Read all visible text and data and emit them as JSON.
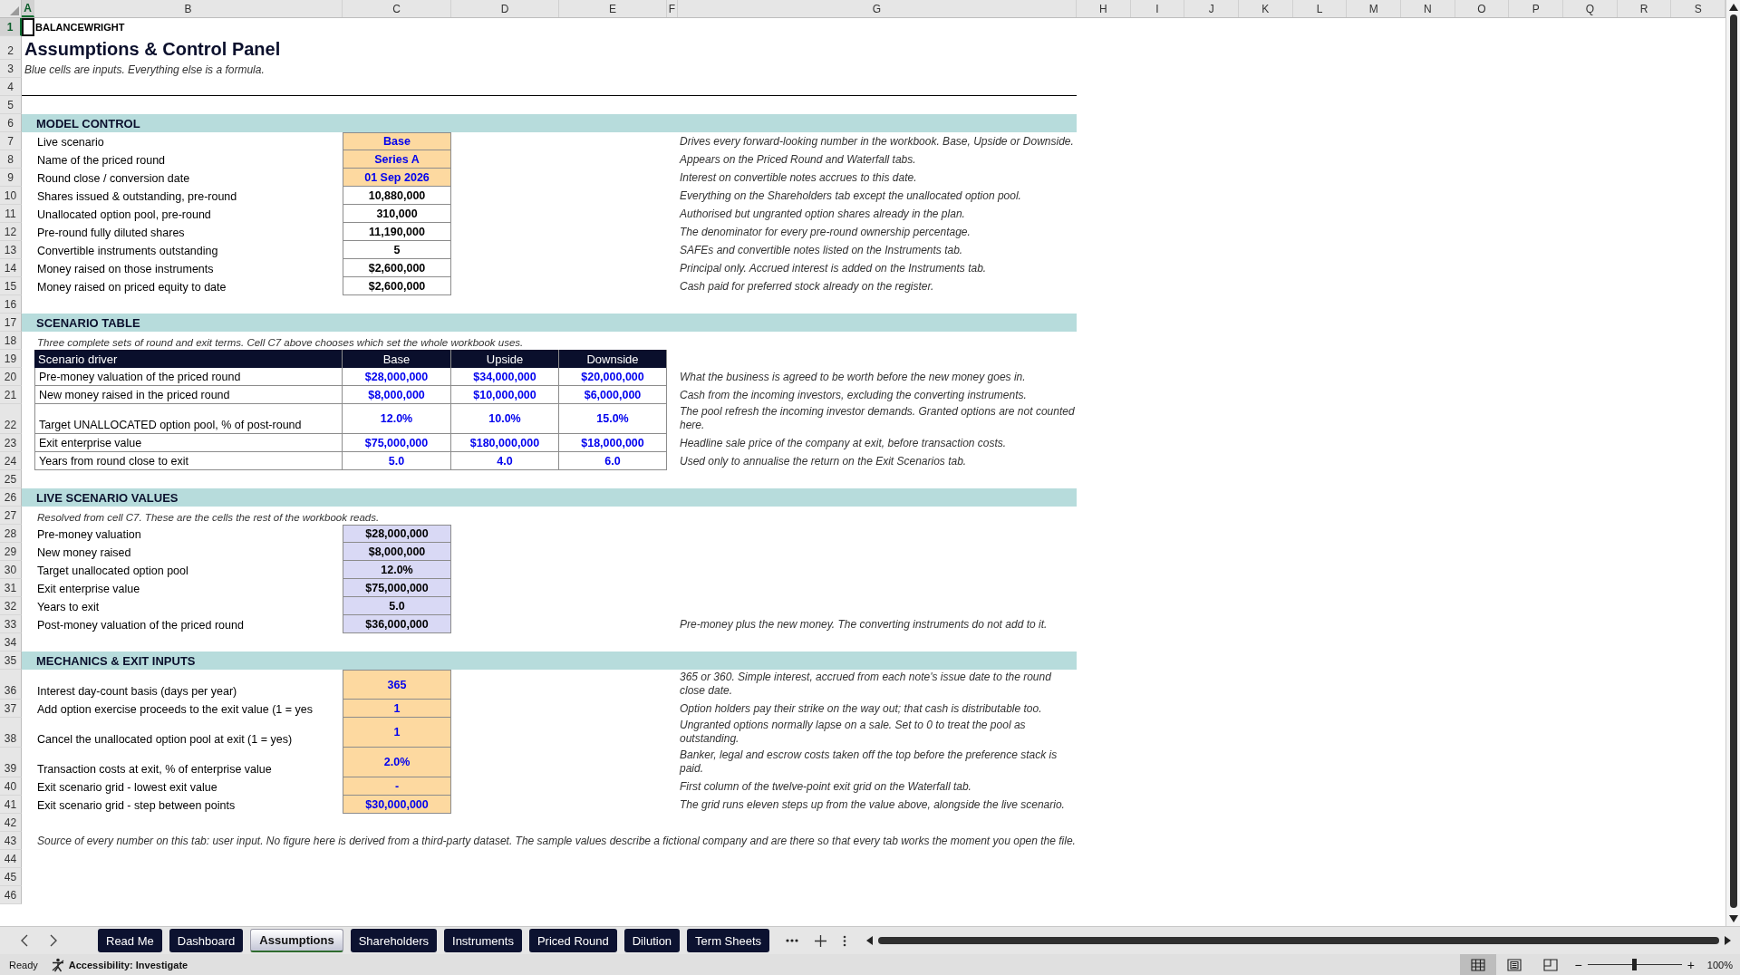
{
  "column_headers": [
    {
      "letter": "A",
      "selected": true
    },
    {
      "letter": "B",
      "selected": false
    },
    {
      "letter": "C",
      "selected": false
    },
    {
      "letter": "D",
      "selected": false
    },
    {
      "letter": "E",
      "selected": false
    },
    {
      "letter": "F",
      "selected": false
    },
    {
      "letter": "G",
      "selected": false
    },
    {
      "letter": "H",
      "selected": false
    },
    {
      "letter": "I",
      "selected": false
    },
    {
      "letter": "J",
      "selected": false
    },
    {
      "letter": "K",
      "selected": false
    },
    {
      "letter": "L",
      "selected": false
    },
    {
      "letter": "M",
      "selected": false
    },
    {
      "letter": "N",
      "selected": false
    },
    {
      "letter": "O",
      "selected": false
    },
    {
      "letter": "P",
      "selected": false
    },
    {
      "letter": "Q",
      "selected": false
    },
    {
      "letter": "R",
      "selected": false
    },
    {
      "letter": "S",
      "selected": false
    }
  ],
  "rows": [
    {
      "row": "1",
      "selected": true,
      "kind": "brand",
      "text": "BALANCEWRIGHT"
    },
    {
      "row": "2",
      "selected": false,
      "kind": "title",
      "text": "Assumptions & Control Panel"
    },
    {
      "row": "3",
      "selected": false,
      "kind": "subtitle",
      "text": "Blue cells are inputs. Everything else is a formula."
    },
    {
      "row": "4",
      "selected": false,
      "kind": "rule"
    },
    {
      "row": "5",
      "selected": false,
      "kind": "blank"
    },
    {
      "row": "6",
      "selected": false,
      "kind": "section",
      "text": "MODEL CONTROL"
    },
    {
      "row": "7",
      "selected": false,
      "kind": "value",
      "label": "Live scenario",
      "value": "Base",
      "input": true,
      "note": "Drives every forward-looking number in the workbook. Base, Upside or Downside."
    },
    {
      "row": "8",
      "selected": false,
      "kind": "value",
      "label": "Name of the priced round",
      "value": "Series A",
      "input": true,
      "note": "Appears on the Priced Round and Waterfall tabs."
    },
    {
      "row": "9",
      "selected": false,
      "kind": "value",
      "label": "Round close / conversion date",
      "value": "01 Sep 2026",
      "input": true,
      "note": "Interest on convertible notes accrues to this date."
    },
    {
      "row": "10",
      "selected": false,
      "kind": "value",
      "label": "Shares issued & outstanding, pre-round",
      "value": "10,880,000",
      "input": false,
      "note": "Everything on the Shareholders tab except the unallocated option pool."
    },
    {
      "row": "11",
      "selected": false,
      "kind": "value",
      "label": "Unallocated option pool, pre-round",
      "value": "310,000",
      "input": false,
      "note": "Authorised but ungranted option shares already in the plan."
    },
    {
      "row": "12",
      "selected": false,
      "kind": "value",
      "label": "Pre-round fully diluted shares",
      "value": "11,190,000",
      "input": false,
      "note": "The denominator for every pre-round ownership percentage."
    },
    {
      "row": "13",
      "selected": false,
      "kind": "value",
      "label": "Convertible instruments outstanding",
      "value": "5",
      "input": false,
      "note": "SAFEs and convertible notes listed on the Instruments tab."
    },
    {
      "row": "14",
      "selected": false,
      "kind": "value",
      "label": "Money raised on those instruments",
      "value": "$2,600,000",
      "input": false,
      "note": "Principal only. Accrued interest is added on the Instruments tab."
    },
    {
      "row": "15",
      "selected": false,
      "kind": "value",
      "label": "Money raised on priced equity to date",
      "value": "$2,600,000",
      "input": false,
      "note": "Cash paid for preferred stock already on the register."
    },
    {
      "row": "16",
      "selected": false,
      "kind": "blank"
    },
    {
      "row": "17",
      "selected": false,
      "kind": "section",
      "text": "SCENARIO TABLE"
    },
    {
      "row": "18",
      "selected": false,
      "kind": "caption",
      "text": "Three complete sets of round and exit terms. Cell C7 above chooses which set the whole workbook uses."
    },
    {
      "row": "19",
      "selected": false,
      "kind": "table_header",
      "label": "Scenario driver",
      "values": [
        "Base",
        "Upside",
        "Downside"
      ]
    },
    {
      "row": "20",
      "selected": false,
      "kind": "table_row",
      "label": "Pre-money valuation of the priced round",
      "values": [
        "$28,000,000",
        "$34,000,000",
        "$20,000,000"
      ],
      "note": "What the business is agreed to be worth before the new money goes in."
    },
    {
      "row": "21",
      "selected": false,
      "kind": "table_row",
      "label": "New money raised in the priced round",
      "values": [
        "$8,000,000",
        "$10,000,000",
        "$6,000,000"
      ],
      "note": "Cash from the incoming investors, excluding the converting instruments."
    },
    {
      "row": "22",
      "selected": false,
      "kind": "table_row",
      "label": "Target UNALLOCATED option pool, % of post-round",
      "values": [
        "12.0%",
        "10.0%",
        "15.0%"
      ],
      "note": "The pool refresh the incoming investor demands. Granted options are not counted here."
    },
    {
      "row": "23",
      "selected": false,
      "kind": "table_row",
      "label": "Exit enterprise value",
      "values": [
        "$75,000,000",
        "$180,000,000",
        "$18,000,000"
      ],
      "note": "Headline sale price of the company at exit, before transaction costs."
    },
    {
      "row": "24",
      "selected": false,
      "kind": "table_row",
      "label": "Years from round close to exit",
      "values": [
        "5.0",
        "4.0",
        "6.0"
      ],
      "note": "Used only to annualise the return on the Exit Scenarios tab."
    },
    {
      "row": "25",
      "selected": false,
      "kind": "blank"
    },
    {
      "row": "26",
      "selected": false,
      "kind": "section",
      "text": "LIVE SCENARIO VALUES"
    },
    {
      "row": "27",
      "selected": false,
      "kind": "caption",
      "text": "Resolved from cell C7. These are the cells the rest of the workbook reads."
    },
    {
      "row": "28",
      "selected": false,
      "kind": "live",
      "label": "Pre-money valuation",
      "value": "$28,000,000"
    },
    {
      "row": "29",
      "selected": false,
      "kind": "live",
      "label": "New money raised",
      "value": "$8,000,000"
    },
    {
      "row": "30",
      "selected": false,
      "kind": "live",
      "label": "Target unallocated option pool",
      "value": "12.0%"
    },
    {
      "row": "31",
      "selected": false,
      "kind": "live",
      "label": "Exit enterprise value",
      "value": "$75,000,000"
    },
    {
      "row": "32",
      "selected": false,
      "kind": "live",
      "label": "Years to exit",
      "value": "5.0"
    },
    {
      "row": "33",
      "selected": false,
      "kind": "live",
      "label": "Post-money valuation of the priced round",
      "value": "$36,000,000",
      "note": "Pre-money plus the new money. The converting instruments do not add to it."
    },
    {
      "row": "34",
      "selected": false,
      "kind": "blank"
    },
    {
      "row": "35",
      "selected": false,
      "kind": "section",
      "text": "MECHANICS & EXIT INPUTS"
    },
    {
      "row": "36",
      "selected": false,
      "kind": "value",
      "label": "Interest day-count basis (days per year)",
      "value": "365",
      "input": true,
      "note": "365 or 360. Simple interest, accrued from each note's issue date to the round close date."
    },
    {
      "row": "37",
      "selected": false,
      "kind": "value",
      "label": "Add option exercise proceeds to the exit value (1 = yes",
      "value": "1",
      "input": true,
      "note": "Option holders pay their strike on the way out; that cash is distributable too."
    },
    {
      "row": "38",
      "selected": false,
      "kind": "value",
      "label": "Cancel the unallocated option pool at exit (1 = yes)",
      "value": "1",
      "input": true,
      "note": "Ungranted options normally lapse on a sale. Set to 0 to treat the pool as outstanding."
    },
    {
      "row": "39",
      "selected": false,
      "kind": "value",
      "label": "Transaction costs at exit, % of enterprise value",
      "value": "2.0%",
      "input": true,
      "note": "Banker, legal and escrow costs taken off the top before the preference stack is paid."
    },
    {
      "row": "40",
      "selected": false,
      "kind": "value",
      "label": "Exit scenario grid - lowest exit value",
      "value": "-",
      "input": true,
      "note": "First column of the twelve-point exit grid on the Waterfall tab."
    },
    {
      "row": "41",
      "selected": false,
      "kind": "value",
      "label": "Exit scenario grid - step between points",
      "value": "$30,000,000",
      "input": true,
      "note": "The grid runs eleven steps up from the value above, alongside the live scenario."
    },
    {
      "row": "42",
      "selected": false,
      "kind": "blank"
    },
    {
      "row": "43",
      "selected": false,
      "kind": "footer",
      "text": "Source of every number on this tab: user input. No figure here is derived from a third-party dataset. The sample values describe a fictional company and are there so that every tab works the moment you open the file."
    },
    {
      "row": "44",
      "selected": false,
      "kind": "blank"
    },
    {
      "row": "45",
      "selected": false,
      "kind": "blank"
    },
    {
      "row": "46",
      "selected": false,
      "kind": "blank"
    }
  ],
  "tabs": [
    {
      "label": "Read Me",
      "selected": false
    },
    {
      "label": "Dashboard",
      "selected": false
    },
    {
      "label": "Assumptions",
      "selected": true
    },
    {
      "label": "Shareholders",
      "selected": false
    },
    {
      "label": "Instruments",
      "selected": false
    },
    {
      "label": "Priced Round",
      "selected": false
    },
    {
      "label": "Dilution",
      "selected": false
    },
    {
      "label": "Term Sheets",
      "selected": false
    }
  ],
  "status_bar": {
    "status": "Ready",
    "accessibility": "Accessibility: Investigate",
    "views": [
      {
        "kind": "normal",
        "selected": true
      },
      {
        "kind": "page_layout",
        "selected": false
      },
      {
        "kind": "page_break",
        "selected": false
      }
    ],
    "zoom": {
      "minus": "−",
      "plus": "+",
      "reading": "100%",
      "level": 0.5
    }
  }
}
